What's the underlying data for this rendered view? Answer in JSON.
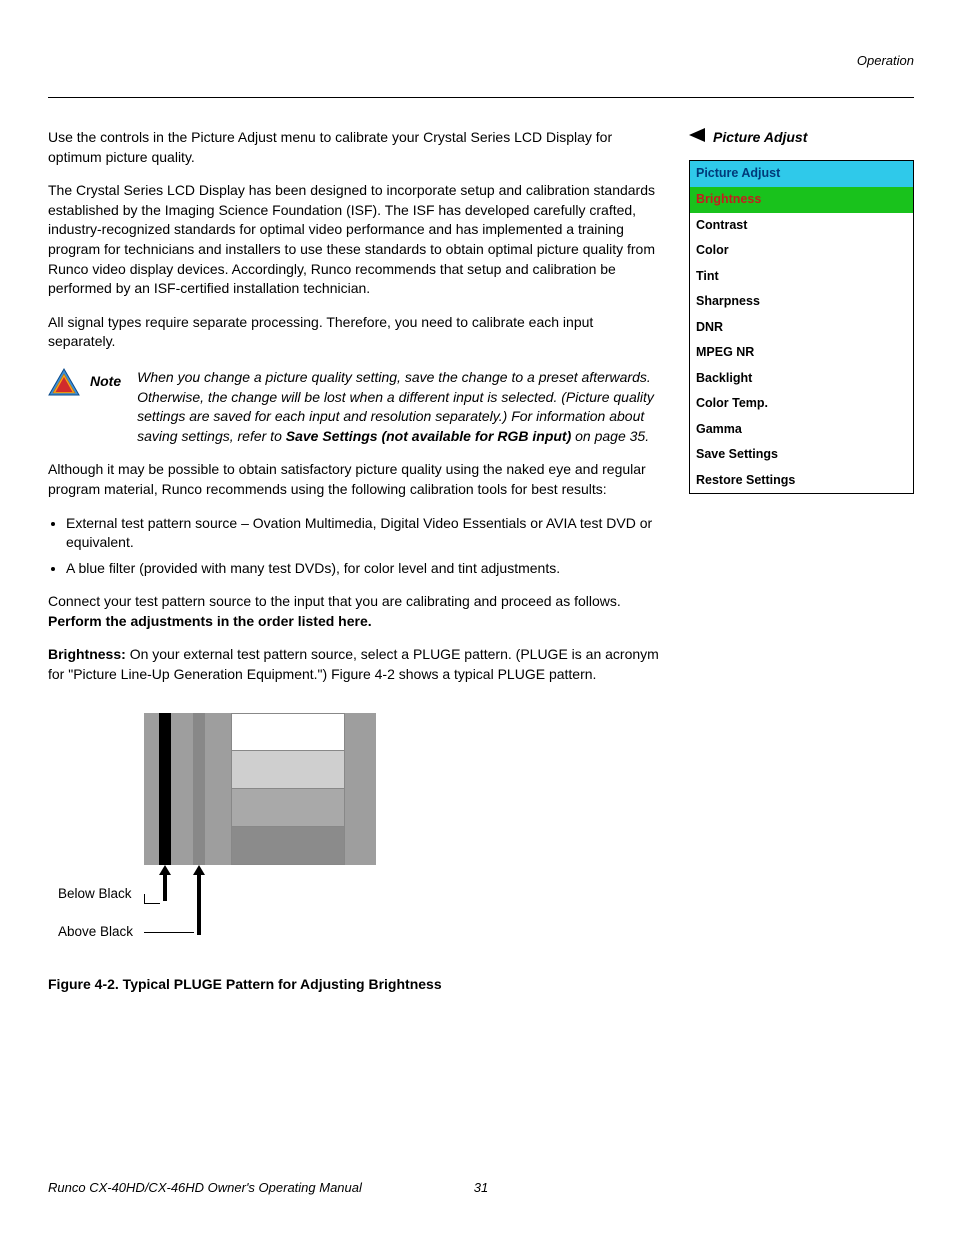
{
  "header": {
    "section": "Operation"
  },
  "body": {
    "p1": "Use the controls in the Picture Adjust menu to calibrate your Crystal Series LCD Display for optimum picture quality.",
    "p2": "The Crystal Series LCD Display has been designed to incorporate setup and calibration standards established by the Imaging Science Foundation (ISF). The ISF has developed carefully crafted, industry-recognized standards for optimal video performance and has implemented a training program for technicians and installers to use these standards to obtain optimal picture quality from Runco video display devices. Accordingly, Runco recommends that setup and calibration be performed by an ISF-certified installation technician.",
    "p3": "All signal types require separate processing. Therefore, you need to calibrate each input separately.",
    "note": {
      "label": "Note",
      "text_a": "When you change a picture quality setting, save the change to a preset afterwards. Otherwise, the change will be lost when a different input is selected. (Picture quality settings are saved for each input and resolution separately.) For information about saving settings, refer to ",
      "text_bold": "Save Settings (not available for RGB input)",
      "text_b": " on page 35."
    },
    "p4": "Although it may be possible to obtain satisfactory picture quality using the naked eye and regular program material, Runco recommends using the following calibration tools for best results:",
    "bullets": [
      "External test pattern source – Ovation Multimedia, Digital Video Essentials or AVIA test DVD or equivalent.",
      "A blue filter (provided with many test DVDs), for color level and tint adjustments."
    ],
    "p5a": "Connect your test pattern source to the input that you are calibrating and proceed as follows. ",
    "p5b": "Perform the adjustments in the order listed here.",
    "brightness_label": "Brightness: ",
    "brightness_text": "On your external test pattern source, select a PLUGE pattern. (PLUGE is an acronym for \"Picture Line-Up Generation Equipment.\") Figure 4-2 shows a typical PLUGE pattern.",
    "fig_below": "Below Black",
    "fig_above": "Above Black",
    "fig_caption": "Figure 4-2. Typical PLUGE Pattern for Adjusting Brightness"
  },
  "sidebar": {
    "heading": "Picture Adjust",
    "menu_title": "Picture Adjust",
    "items": [
      "Brightness",
      "Contrast",
      "Color",
      "Tint",
      "Sharpness",
      "DNR",
      "MPEG NR",
      "Backlight",
      "Color Temp.",
      "Gamma",
      "Save Settings",
      "Restore Settings"
    ]
  },
  "footer": {
    "title": "Runco CX-40HD/CX-46HD Owner's Operating Manual",
    "page": "31"
  }
}
